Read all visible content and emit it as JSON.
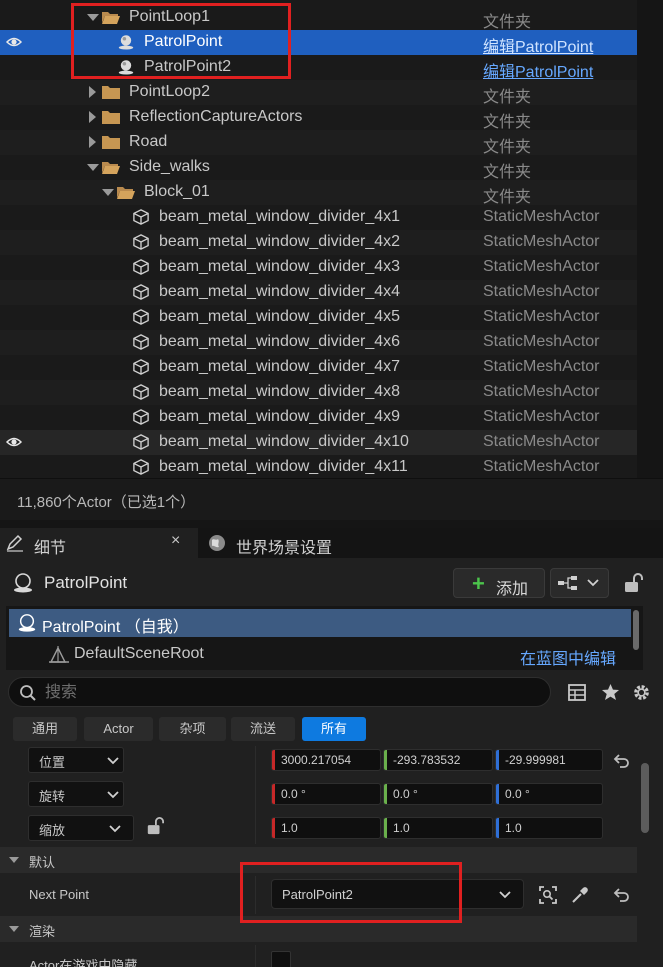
{
  "outliner": {
    "rows": [
      {
        "name": "PointLoop1",
        "type": "文件夹",
        "kind": "folder-open",
        "indent": 1,
        "expanded": true
      },
      {
        "name": "PatrolPoint",
        "type": "编辑PatrolPoint",
        "kind": "sphere",
        "indent": 2,
        "selected": true,
        "visible": true
      },
      {
        "name": "PatrolPoint2",
        "type": "编辑PatrolPoint",
        "kind": "sphere",
        "indent": 2
      },
      {
        "name": "PointLoop2",
        "type": "文件夹",
        "kind": "folder",
        "indent": 1
      },
      {
        "name": "ReflectionCaptureActors",
        "type": "文件夹",
        "kind": "folder",
        "indent": 1
      },
      {
        "name": "Road",
        "type": "文件夹",
        "kind": "folder",
        "indent": 1
      },
      {
        "name": "Side_walks",
        "type": "文件夹",
        "kind": "folder-open",
        "indent": 1,
        "expanded": true
      },
      {
        "name": "Block_01",
        "type": "文件夹",
        "kind": "folder-open",
        "indent": 2,
        "expanded": true
      },
      {
        "name": "beam_metal_window_divider_4x1",
        "type": "StaticMeshActor",
        "kind": "mesh",
        "indent": 3
      },
      {
        "name": "beam_metal_window_divider_4x2",
        "type": "StaticMeshActor",
        "kind": "mesh",
        "indent": 3
      },
      {
        "name": "beam_metal_window_divider_4x3",
        "type": "StaticMeshActor",
        "kind": "mesh",
        "indent": 3
      },
      {
        "name": "beam_metal_window_divider_4x4",
        "type": "StaticMeshActor",
        "kind": "mesh",
        "indent": 3
      },
      {
        "name": "beam_metal_window_divider_4x5",
        "type": "StaticMeshActor",
        "kind": "mesh",
        "indent": 3
      },
      {
        "name": "beam_metal_window_divider_4x6",
        "type": "StaticMeshActor",
        "kind": "mesh",
        "indent": 3
      },
      {
        "name": "beam_metal_window_divider_4x7",
        "type": "StaticMeshActor",
        "kind": "mesh",
        "indent": 3
      },
      {
        "name": "beam_metal_window_divider_4x8",
        "type": "StaticMeshActor",
        "kind": "mesh",
        "indent": 3
      },
      {
        "name": "beam_metal_window_divider_4x9",
        "type": "StaticMeshActor",
        "kind": "mesh",
        "indent": 3
      },
      {
        "name": "beam_metal_window_divider_4x10",
        "type": "StaticMeshActor",
        "kind": "mesh",
        "indent": 3,
        "visible": true
      },
      {
        "name": "beam_metal_window_divider_4x11",
        "type": "StaticMeshActor",
        "kind": "mesh",
        "indent": 3
      }
    ],
    "footer": "11,860个Actor（已选1个）"
  },
  "tabs": {
    "details": "细节",
    "close": "×",
    "world_settings": "世界场景设置"
  },
  "details": {
    "actor_name": "PatrolPoint",
    "add_label": "添加",
    "components": {
      "root": "PatrolPoint （自我）",
      "child": "DefaultSceneRoot",
      "edit_in_blueprint": "在蓝图中编辑"
    },
    "search_placeholder": "搜索",
    "filters": [
      "通用",
      "Actor",
      "杂项",
      "流送",
      "所有"
    ],
    "active_filter": "所有",
    "transform": {
      "location": {
        "label": "位置",
        "x": "3000.217054",
        "y": "-293.783532",
        "z": "-29.999981"
      },
      "rotation": {
        "label": "旋转",
        "x": "0.0 °",
        "y": "0.0 °",
        "z": "0.0 °"
      },
      "scale": {
        "label": "缩放",
        "x": "1.0",
        "y": "1.0",
        "z": "1.0"
      }
    },
    "default_section": "默认",
    "next_point_label": "Next Point",
    "next_point_value": "PatrolPoint2",
    "render_section": "渲染",
    "hidden_in_game_label": "Actor在游戏中隐藏"
  },
  "colors": {
    "selection": "#1f5fbf",
    "link": "#66a8ff",
    "x_axis": "#c62828",
    "y_axis": "#6ab04c",
    "z_axis": "#2f6fd6",
    "highlight": "#e02020",
    "accent": "#0e7ae0"
  }
}
